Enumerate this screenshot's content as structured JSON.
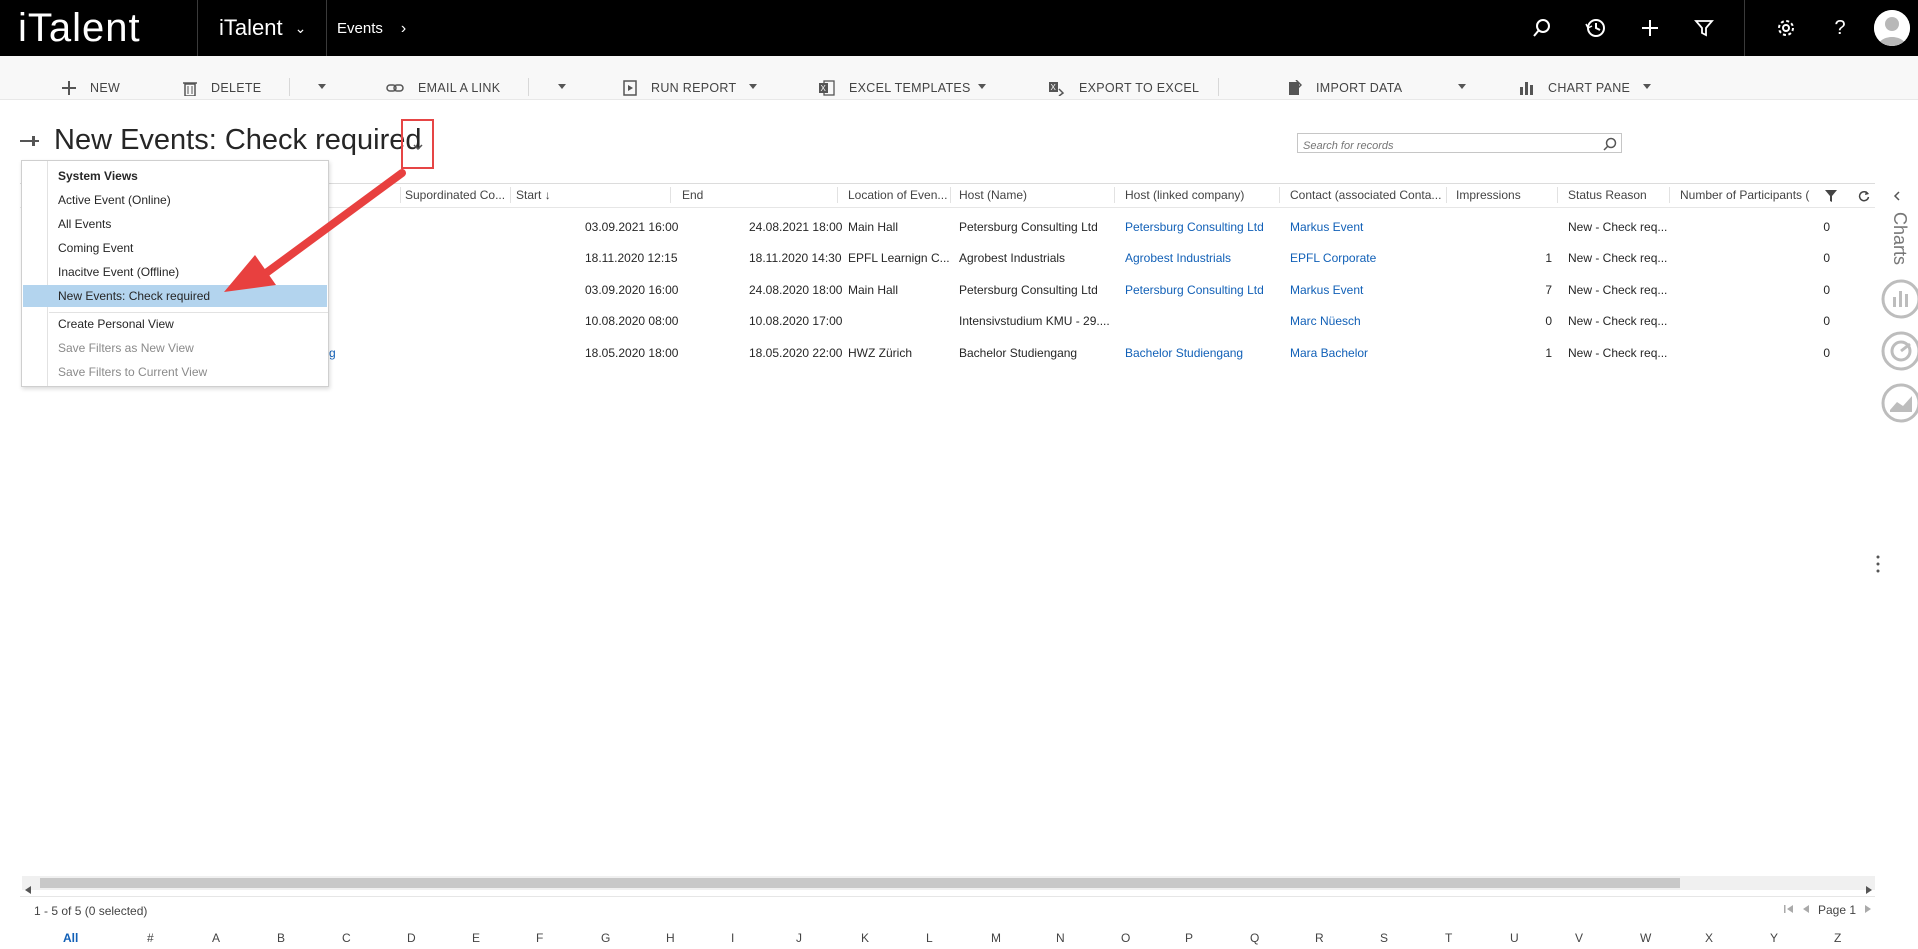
{
  "app": {
    "logo": "iTalent",
    "switcher_label": "iTalent",
    "breadcrumb": "Events"
  },
  "commands": {
    "new": "NEW",
    "delete": "DELETE",
    "email_link": "EMAIL A LINK",
    "run_report": "RUN REPORT",
    "excel_templates": "EXCEL TEMPLATES",
    "export_excel": "EXPORT TO EXCEL",
    "import_data": "IMPORT DATA",
    "chart_pane": "CHART PANE"
  },
  "view": {
    "title": "New Events: Check required",
    "search_placeholder": "Search for records"
  },
  "columns": [
    "Supordinated Co...",
    "Start",
    "End",
    "Location of Even...",
    "Host (Name)",
    "Host (linked company)",
    "Contact (associated Conta...",
    "Impressions",
    "Status Reason",
    "Number of Participants ("
  ],
  "rows": [
    {
      "name": "",
      "start": "03.09.2021 16:00",
      "end": "24.08.2021 18:00",
      "location": "Main Hall",
      "host": "Petersburg Consulting Ltd",
      "host_company": "Petersburg Consulting Ltd",
      "contact": "Markus Event",
      "impressions": "",
      "status": "New - Check req...",
      "participants": "0"
    },
    {
      "name": "",
      "start": "18.11.2020 12:15",
      "end": "18.11.2020 14:30",
      "location": "EPFL Learnign C...",
      "host": "Agrobest Industrials",
      "host_company": "Agrobest Industrials",
      "contact": "EPFL Corporate",
      "impressions": "1",
      "status": "New - Check req...",
      "participants": "0"
    },
    {
      "name": "",
      "start": "03.09.2020 16:00",
      "end": "24.08.2020 18:00",
      "location": "Main Hall",
      "host": "Petersburg Consulting Ltd",
      "host_company": "Petersburg Consulting Ltd",
      "contact": "Markus Event",
      "impressions": "7",
      "status": "New - Check req...",
      "participants": "0"
    },
    {
      "name": "",
      "start": "10.08.2020 08:00",
      "end": "10.08.2020 17:00",
      "location": "",
      "host": "Intensivstudium KMU - 29....",
      "host_company": "",
      "contact": "Marc Nüesch",
      "impressions": "0",
      "status": "New - Check req...",
      "participants": "0"
    },
    {
      "name": "gang",
      "start": "18.05.2020 18:00",
      "end": "18.05.2020 22:00",
      "location": "HWZ Zürich",
      "host": "Bachelor Studiengang",
      "host_company": "Bachelor Studiengang",
      "contact": "Mara Bachelor",
      "impressions": "1",
      "status": "New - Check req...",
      "participants": "0"
    }
  ],
  "dropdown": {
    "header": "System Views",
    "items": [
      "Active Event (Online)",
      "All Events",
      "Coming Event",
      "Inacitve Event (Offline)",
      "New Events: Check required"
    ],
    "personal": "Create Personal View",
    "save_new": "Save Filters as New View",
    "save_current": "Save Filters to Current View"
  },
  "rail": {
    "charts_label": "Charts"
  },
  "footer": {
    "status": "1 - 5 of 5 (0 selected)",
    "page": "Page 1",
    "letters": [
      "All",
      "#",
      "A",
      "B",
      "C",
      "D",
      "E",
      "F",
      "G",
      "H",
      "I",
      "J",
      "K",
      "L",
      "M",
      "N",
      "O",
      "P",
      "Q",
      "R",
      "S",
      "T",
      "U",
      "V",
      "W",
      "X",
      "Y",
      "Z"
    ]
  },
  "colors": {
    "topbar": "#000000",
    "link": "#1160b7",
    "selection": "#b3d4ee",
    "highlight_box": "#e64545",
    "arrow": "#e8403f"
  }
}
